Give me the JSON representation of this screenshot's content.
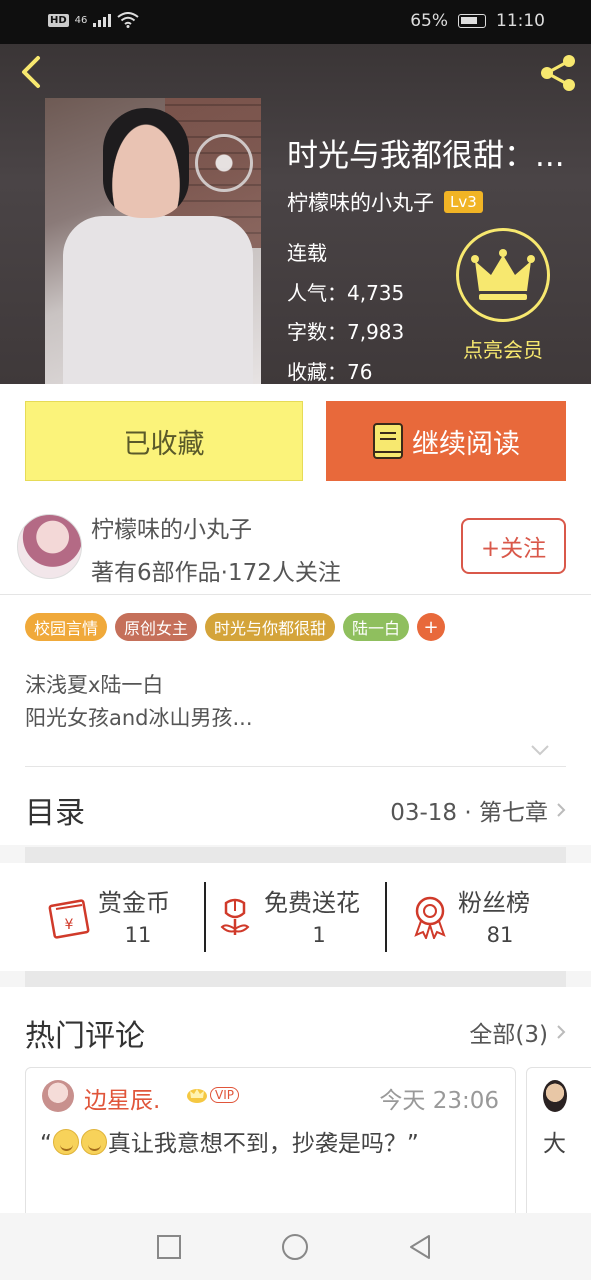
{
  "status_bar": {
    "hd": "HD",
    "network": "46",
    "battery_percent": "65%",
    "time": "11:10"
  },
  "book": {
    "title": "时光与我都很甜：...",
    "author": "柠檬味的小丸子",
    "level": "Lv3",
    "status": "连载",
    "popularity": "人气：4,735",
    "word_count": "字数：7,983",
    "favorites": "收藏：76",
    "vip_label": "点亮会员"
  },
  "actions": {
    "collected_label": "已收藏",
    "continue_label": "继续阅读"
  },
  "author": {
    "name": "柠檬味的小丸子",
    "stats": "著有6部作品·172人关注",
    "follow_label": "+关注"
  },
  "tags": [
    {
      "label": "校园言情",
      "color": "#f0a93a"
    },
    {
      "label": "原创女主",
      "color": "#c5705a"
    },
    {
      "label": "时光与你都很甜",
      "color": "#d4a43a"
    },
    {
      "label": "陆一白",
      "color": "#8fbf5e"
    }
  ],
  "tag_add": "+",
  "description": {
    "line1": "沫浅夏x陆一白",
    "line2": "阳光女孩and冰山男孩..."
  },
  "toc": {
    "title": "目录",
    "latest": "03-18 · 第七章"
  },
  "rewards": [
    {
      "label": "赏金币",
      "count": "11",
      "icon": "red-packet-icon"
    },
    {
      "label": "免费送花",
      "count": "1",
      "icon": "flower-icon"
    },
    {
      "label": "粉丝榜",
      "count": "81",
      "icon": "medal-icon"
    }
  ],
  "comments": {
    "title": "热门评论",
    "all_label": "全部(3)",
    "items": [
      {
        "user": "边星辰.",
        "vip": "VIP",
        "time": "今天 23:06",
        "text": "真让我意想不到，抄袭是吗？”",
        "quote_open": "“"
      }
    ],
    "next_preview_text": "大"
  },
  "colors": {
    "accent_orange": "#e8693b",
    "collected_yellow": "#fbf37a",
    "vip_gold": "#f7e86f",
    "follow_red": "#d9584a"
  }
}
